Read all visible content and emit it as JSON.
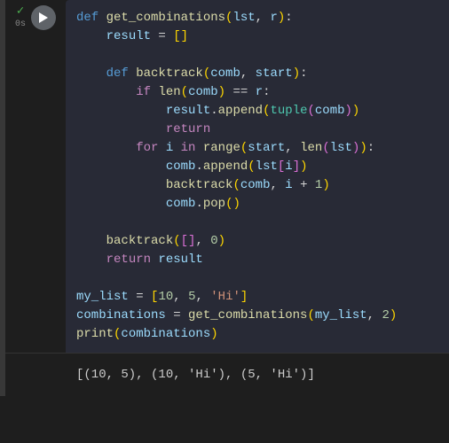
{
  "execution": {
    "status_icon": "✓",
    "time": "0s"
  },
  "code": {
    "l1": {
      "def": "def ",
      "fn": "get_combinations",
      "open": "(",
      "p1": "lst",
      "comma": ", ",
      "p2": "r",
      "close": ")",
      "colon": ":"
    },
    "l2": {
      "indent": "    ",
      "var": "result ",
      "eq": "= ",
      "val": "[]"
    },
    "l3": "",
    "l4": {
      "indent": "    ",
      "def": "def ",
      "fn": "backtrack",
      "open": "(",
      "p1": "comb",
      "comma": ", ",
      "p2": "start",
      "close": ")",
      "colon": ":"
    },
    "l5": {
      "indent": "        ",
      "if": "if ",
      "fn": "len",
      "open": "(",
      "arg": "comb",
      "close": ") ",
      "op": "== ",
      "var": "r",
      "colon": ":"
    },
    "l6": {
      "indent": "            ",
      "obj": "result",
      "dot": ".",
      "method": "append",
      "open": "(",
      "fn": "tuple",
      "open2": "(",
      "arg": "comb",
      "close2": ")",
      "close": ")"
    },
    "l7": {
      "indent": "            ",
      "ret": "return"
    },
    "l8": {
      "indent": "        ",
      "for": "for ",
      "var": "i ",
      "in": "in ",
      "fn": "range",
      "open": "(",
      "arg1": "start",
      "comma": ", ",
      "fn2": "len",
      "open2": "(",
      "arg2": "lst",
      "close2": ")",
      "close": ")",
      "colon": ":"
    },
    "l9": {
      "indent": "            ",
      "obj": "comb",
      "dot": ".",
      "method": "append",
      "open": "(",
      "arg": "lst",
      "bopen": "[",
      "idx": "i",
      "bclose": "]",
      "close": ")"
    },
    "l10": {
      "indent": "            ",
      "fn": "backtrack",
      "open": "(",
      "arg1": "comb",
      "comma": ", ",
      "arg2": "i ",
      "op": "+ ",
      "num": "1",
      "close": ")"
    },
    "l11": {
      "indent": "            ",
      "obj": "comb",
      "dot": ".",
      "method": "pop",
      "open": "(",
      ")": ")"
    },
    "l12": "",
    "l13": {
      "indent": "    ",
      "fn": "backtrack",
      "open": "(",
      "arg": "[]",
      "comma": ", ",
      "num": "0",
      "close": ")"
    },
    "l14": {
      "indent": "    ",
      "ret": "return ",
      "var": "result"
    },
    "l15": "",
    "l16": {
      "var": "my_list ",
      "eq": "= ",
      "open": "[",
      "n1": "10",
      "c1": ", ",
      "n2": "5",
      "c2": ", ",
      "str": "'Hi'",
      "close": "]"
    },
    "l17": {
      "var": "combinations ",
      "eq": "= ",
      "fn": "get_combinations",
      "open": "(",
      "arg1": "my_list",
      "comma": ", ",
      "num": "2",
      "close": ")"
    },
    "l18": {
      "fn": "print",
      "open": "(",
      "arg": "combinations",
      "close": ")"
    }
  },
  "output": "[(10, 5), (10, 'Hi'), (5, 'Hi')]"
}
